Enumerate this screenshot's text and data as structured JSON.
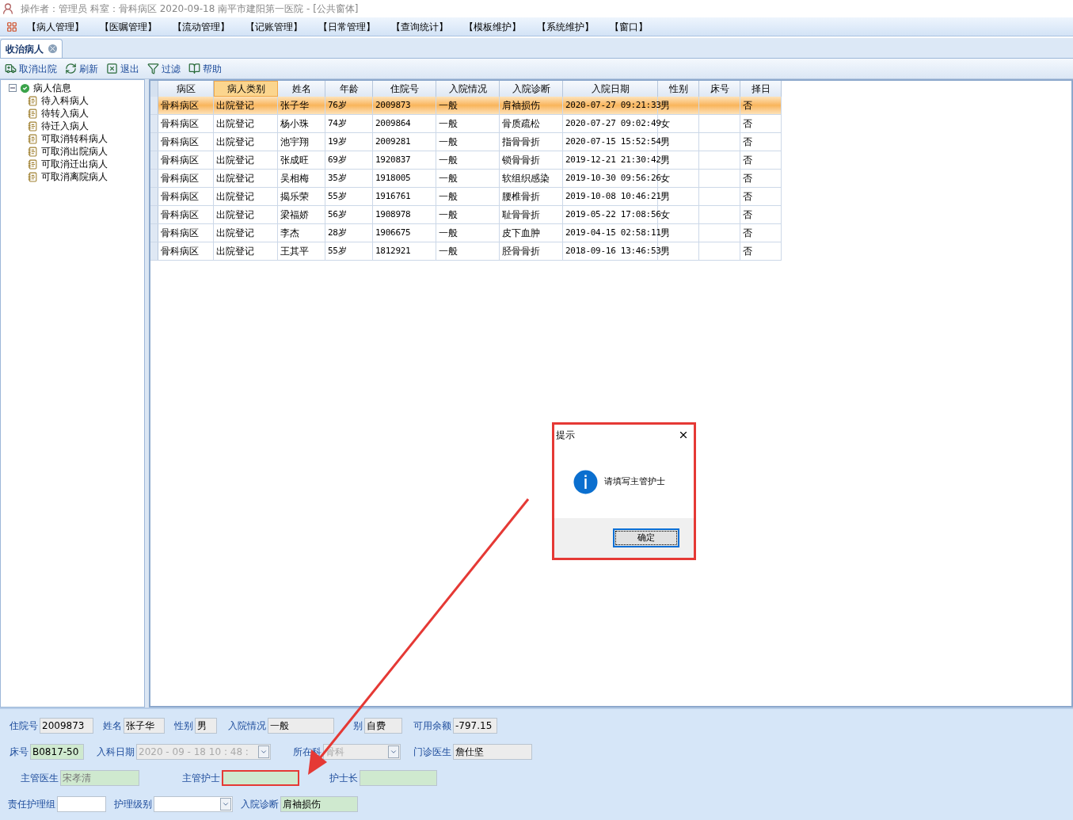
{
  "title_bar": {
    "title": "操作者：管理员  科室：骨科病区  2020-09-18  南平市建阳第一医院 - [公共窗体]"
  },
  "menu": [
    "【病人管理】",
    "【医嘱管理】",
    "【流动管理】",
    "【记账管理】",
    "【日常管理】",
    "【查询统计】",
    "【模板维护】",
    "【系统维护】",
    "【窗口】"
  ],
  "tabs": [
    {
      "label": "收治病人",
      "selected": true
    }
  ],
  "toolbar": [
    {
      "label": "取消出院",
      "kind": "cancel"
    },
    {
      "label": "刷新",
      "kind": "refresh"
    },
    {
      "label": "退出",
      "kind": "exit"
    },
    {
      "label": "过滤",
      "kind": "filter"
    },
    {
      "label": "帮助",
      "kind": "help"
    }
  ],
  "tree": {
    "label": "病人信息",
    "expanded": true,
    "children": [
      {
        "label": "待入科病人"
      },
      {
        "label": "待转入病人"
      },
      {
        "label": "待迁入病人"
      },
      {
        "label": "可取消转科病人"
      },
      {
        "label": "可取消出院病人"
      },
      {
        "label": "可取消迁出病人"
      },
      {
        "label": "可取消离院病人"
      }
    ]
  },
  "table": {
    "columns": [
      {
        "label": "病区",
        "selected": false
      },
      {
        "label": "病人类别",
        "selected": true
      },
      {
        "label": "姓名",
        "selected": false
      },
      {
        "label": "年龄",
        "selected": false
      },
      {
        "label": "住院号",
        "selected": false
      },
      {
        "label": "入院情况",
        "selected": false
      },
      {
        "label": "入院诊断",
        "selected": false
      },
      {
        "label": "入院日期",
        "selected": false
      },
      {
        "label": "性别",
        "selected": false
      },
      {
        "label": "床号",
        "selected": false
      },
      {
        "label": "择日",
        "selected": false
      }
    ],
    "rows": [
      {
        "selected": true,
        "cells": [
          "骨科病区",
          "出院登记",
          "张子华",
          "76岁",
          "2009873",
          "一般",
          "肩袖损伤",
          "2020-07-27 09:21:33",
          "男",
          "",
          "否"
        ]
      },
      {
        "selected": false,
        "cells": [
          "骨科病区",
          "出院登记",
          "杨小珠",
          "74岁",
          "2009864",
          "一般",
          "骨质疏松",
          "2020-07-27 09:02:49",
          "女",
          "",
          "否"
        ]
      },
      {
        "selected": false,
        "cells": [
          "骨科病区",
          "出院登记",
          "池宇翔",
          "19岁",
          "2009281",
          "一般",
          "指骨骨折",
          "2020-07-15 15:52:54",
          "男",
          "",
          "否"
        ]
      },
      {
        "selected": false,
        "cells": [
          "骨科病区",
          "出院登记",
          "张成旺",
          "69岁",
          "1920837",
          "一般",
          "锁骨骨折",
          "2019-12-21 21:30:42",
          "男",
          "",
          "否"
        ]
      },
      {
        "selected": false,
        "cells": [
          "骨科病区",
          "出院登记",
          "吴相梅",
          "35岁",
          "1918005",
          "一般",
          "软组织感染",
          "2019-10-30 09:56:26",
          "女",
          "",
          "否"
        ]
      },
      {
        "selected": false,
        "cells": [
          "骨科病区",
          "出院登记",
          "揭乐荣",
          "55岁",
          "1916761",
          "一般",
          "腰椎骨折",
          "2019-10-08 10:46:21",
          "男",
          "",
          "否"
        ]
      },
      {
        "selected": false,
        "cells": [
          "骨科病区",
          "出院登记",
          "梁福娇",
          "56岁",
          "1908978",
          "一般",
          "耻骨骨折",
          "2019-05-22 17:08:56",
          "女",
          "",
          "否"
        ]
      },
      {
        "selected": false,
        "cells": [
          "骨科病区",
          "出院登记",
          "李杰",
          "28岁",
          "1906675",
          "一般",
          "皮下血肿",
          "2019-04-15 02:58:11",
          "男",
          "",
          "否"
        ]
      },
      {
        "selected": false,
        "cells": [
          "骨科病区",
          "出院登记",
          "王其平",
          "55岁",
          "1812921",
          "一般",
          "胫骨骨折",
          "2018-09-16 13:46:53",
          "男",
          "",
          "否"
        ]
      }
    ]
  },
  "form": [
    [
      {
        "label": "住院号",
        "value": "2009873",
        "kind": "text",
        "readonly": true,
        "required": false
      },
      {
        "label": "姓名",
        "value": "张子华",
        "kind": "text",
        "readonly": true,
        "required": false
      },
      {
        "label": "性别",
        "value": "男",
        "kind": "text",
        "readonly": true,
        "required": false
      },
      {
        "label": "入院情况",
        "value": "一般",
        "kind": "text",
        "readonly": true,
        "required": false
      },
      {
        "label": "别",
        "value": "自费",
        "kind": "text",
        "readonly": true,
        "required": false
      },
      {
        "label": "可用余额",
        "value": "-797.15",
        "kind": "text",
        "readonly": true,
        "required": false
      }
    ],
    [
      {
        "label": "床号",
        "value": "B0817-50",
        "kind": "text",
        "readonly": false,
        "required": true
      },
      {
        "label": "入科日期",
        "value": "2020 - 09 - 18    10 : 48 :",
        "kind": "date",
        "readonly": true,
        "required": false
      },
      {
        "label": "所在科",
        "value": "骨科",
        "kind": "combo",
        "readonly": true,
        "required": false
      },
      {
        "label": "门诊医生",
        "value": "詹仕坚",
        "kind": "text",
        "readonly": true,
        "required": false
      }
    ],
    [
      {
        "label": "主管医生",
        "value": "宋孝清",
        "kind": "text",
        "readonly": true,
        "required": true
      },
      {
        "label": "主管护士",
        "kind": "text",
        "readonly": false,
        "required": true,
        "highlighted": true
      },
      {
        "label": "护士长",
        "kind": "text",
        "readonly": false,
        "required": true
      }
    ],
    [
      {
        "label": "责任护理组",
        "kind": "text",
        "readonly": false,
        "required": false
      },
      {
        "label": "护理级别",
        "kind": "combo",
        "readonly": false,
        "required": false
      },
      {
        "label": "入院诊断",
        "value": "肩袖损伤",
        "kind": "text",
        "readonly": false,
        "required": true
      }
    ]
  ],
  "dialog": {
    "title": "提示",
    "message": "请填写主管护士",
    "button": "确定"
  }
}
